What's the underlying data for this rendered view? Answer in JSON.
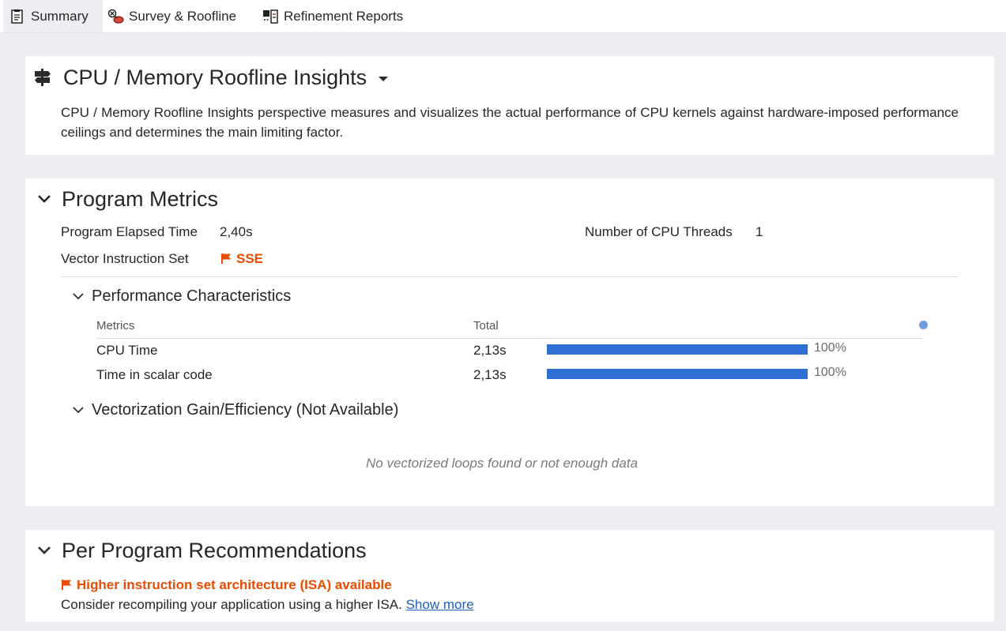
{
  "tabs": [
    {
      "label": "Summary",
      "icon": "summary-report-icon",
      "active": true
    },
    {
      "label": "Survey & Roofline",
      "icon": "survey-roofline-icon",
      "active": false
    },
    {
      "label": "Refinement Reports",
      "icon": "refinement-reports-icon",
      "active": false
    }
  ],
  "insights": {
    "title": "CPU / Memory Roofline Insights",
    "description": "CPU / Memory Roofline Insights perspective measures and visualizes the actual performance of CPU kernels against hardware-imposed performance ceilings and determines the main limiting factor."
  },
  "program_metrics": {
    "title": "Program Metrics",
    "elapsed_label": "Program Elapsed Time",
    "elapsed_value": "2,40s",
    "threads_label": "Number of CPU Threads",
    "threads_value": "1",
    "isa_label": "Vector Instruction Set",
    "isa_value": "SSE",
    "perf": {
      "title": "Performance Characteristics",
      "col_metrics": "Metrics",
      "col_total": "Total",
      "rows": [
        {
          "name": "CPU Time",
          "total": "2,13s",
          "percent_label": "100%",
          "fraction": 1.0
        },
        {
          "name": "Time in scalar code",
          "total": "2,13s",
          "percent_label": "100%",
          "fraction": 1.0
        }
      ]
    },
    "vector": {
      "title": "Vectorization Gain/Efficiency (Not Available)",
      "empty_message": "No vectorized loops found or not enough data"
    }
  },
  "recommendations": {
    "title": "Per Program Recommendations",
    "issue_title": "Higher instruction set architecture (ISA) available",
    "issue_text": "Consider recompiling your application using a higher ISA.",
    "show_more": "Show more"
  },
  "colors": {
    "accent_bar": "#2e6fd4",
    "warning": "#e84c00",
    "link": "#1f5fbf"
  }
}
